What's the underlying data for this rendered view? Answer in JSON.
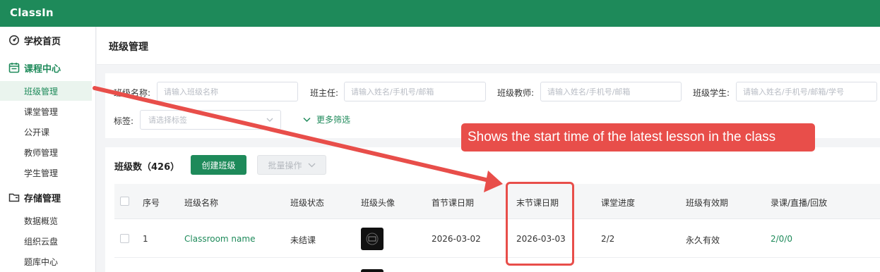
{
  "app": {
    "logo": "ClassIn"
  },
  "sidebar": {
    "groups": [
      {
        "label": "学校首页",
        "icon": "dashboard-icon"
      },
      {
        "label": "课程中心",
        "icon": "calendar-icon"
      },
      {
        "label": "存储管理",
        "icon": "folder-icon"
      }
    ],
    "course_items": [
      "班级管理",
      "课堂管理",
      "公开课",
      "教师管理",
      "学生管理"
    ],
    "storage_items": [
      "数据概览",
      "组织云盘",
      "题库中心"
    ]
  },
  "page": {
    "title": "班级管理"
  },
  "filters": {
    "class_name": {
      "label": "班级名称:",
      "placeholder": "请输入班级名称"
    },
    "head_teacher": {
      "label": "班主任:",
      "placeholder": "请输入姓名/手机号/邮箱"
    },
    "class_teacher": {
      "label": "班级教师:",
      "placeholder": "请输入姓名/手机号/邮箱"
    },
    "class_student": {
      "label": "班级学生:",
      "placeholder": "请输入姓名/手机号/邮箱/学号"
    },
    "tags": {
      "label": "标签:",
      "placeholder": "请选择标签"
    },
    "more": "更多筛选"
  },
  "table": {
    "count_label": "班级数（426）",
    "create_button": "创建班级",
    "batch_button": "批量操作",
    "headers": [
      "序号",
      "班级名称",
      "班级状态",
      "班级头像",
      "首节课日期",
      "末节课日期",
      "课堂进度",
      "班级有效期",
      "录课/直播/回放"
    ],
    "rows": [
      {
        "index": "1",
        "name": "Classroom name",
        "status": "未结课",
        "first_lesson": "2026-03-02",
        "last_lesson": "2026-03-03",
        "progress": "2/2",
        "validity": "永久有效",
        "recordings": "2/0/0"
      }
    ]
  },
  "annotation": {
    "callout": "Shows the start time of the latest lesson in the class",
    "color": "#e84e4a"
  },
  "colors": {
    "brand": "#1e8a5a",
    "annotation": "#e84e4a"
  }
}
